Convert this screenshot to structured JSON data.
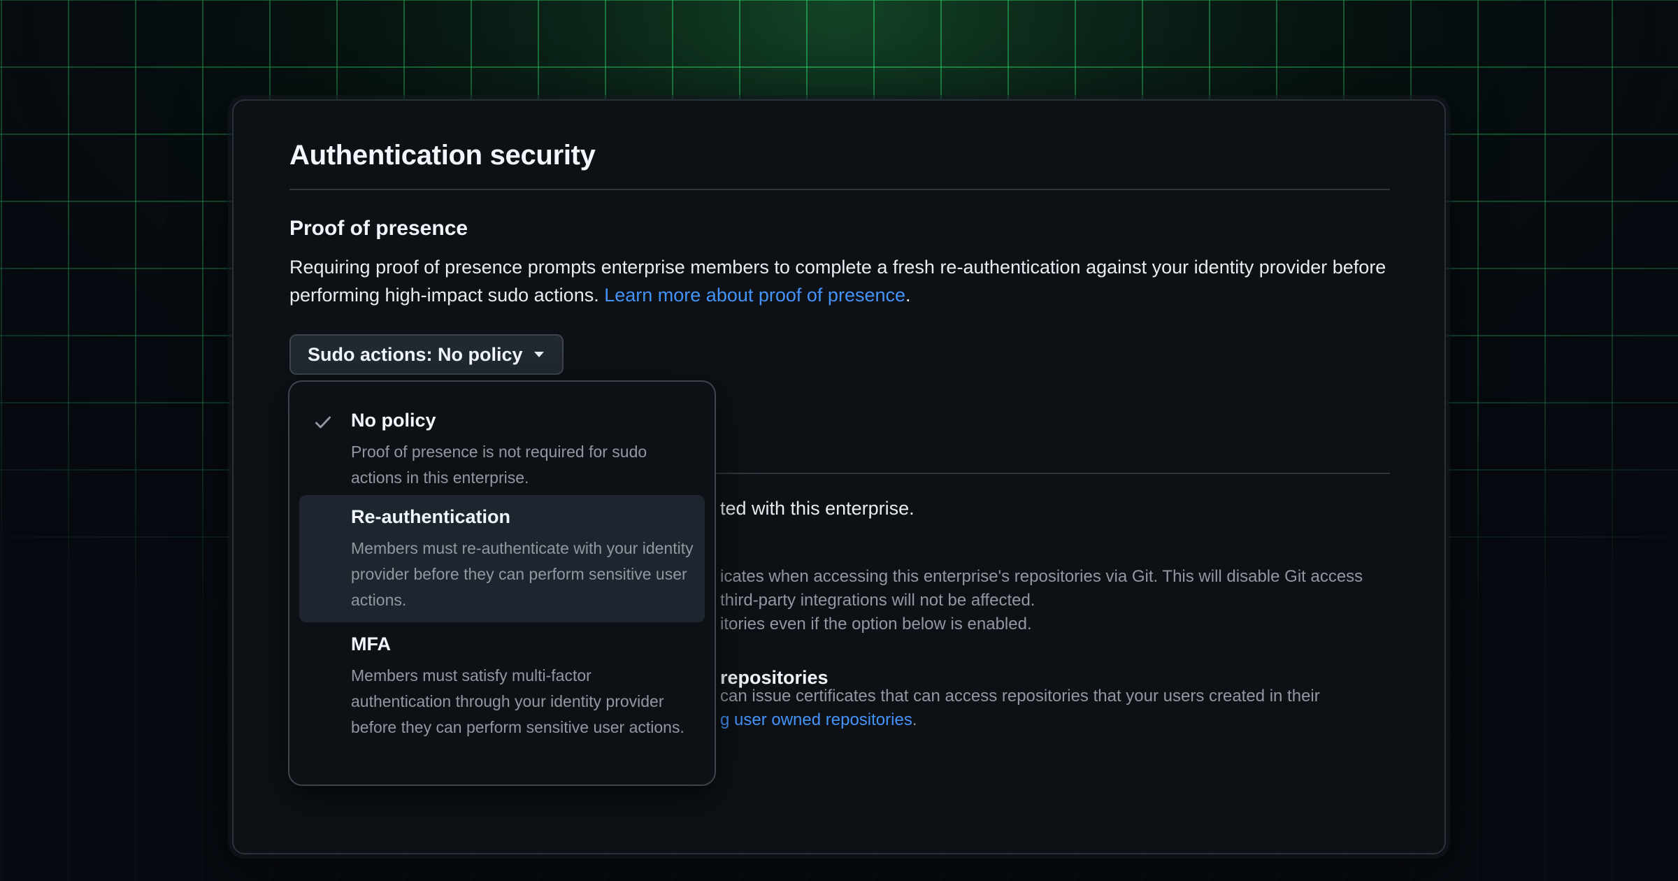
{
  "card": {
    "title": "Authentication security"
  },
  "proof_of_presence": {
    "title": "Proof of presence",
    "description": "Requiring proof of presence prompts enterprise members to complete a fresh re-authentication against your identity provider before performing high-impact sudo actions.",
    "link_text": "Learn more about proof of presence",
    "trailing_period": "."
  },
  "dropdown": {
    "label": "Sudo actions: No policy",
    "options": [
      {
        "label": "No policy",
        "description": "Proof of presence is not required for sudo actions in this enterprise.",
        "selected": true
      },
      {
        "label": "Re-authentication",
        "description": "Members must re-authenticate with your identity provider before they can perform sensitive user actions.",
        "selected": false
      },
      {
        "label": "MFA",
        "description": "Members must satisfy multi-factor authentication through your identity provider before they can perform sensitive user actions.",
        "selected": false
      }
    ]
  },
  "obscured": {
    "line1": "ted with this enterprise.",
    "line2": "icates when accessing this enterprise's repositories via Git. This will disable Git access",
    "line3": "third-party integrations will not be affected.",
    "line4": "itories even if the option below is enabled.",
    "heading": "repositories",
    "line5": "can issue certificates that can access repositories that your users created in their",
    "link": "g user owned repositories",
    "link_period": "."
  },
  "colors": {
    "background": "#060a10",
    "grid": "#2fd16a",
    "card": "#0d1116",
    "accent_link": "#4493f8",
    "menu_highlight": "#1e252e"
  },
  "icons": {
    "check": "check-icon",
    "caret": "triangle-down-icon"
  }
}
